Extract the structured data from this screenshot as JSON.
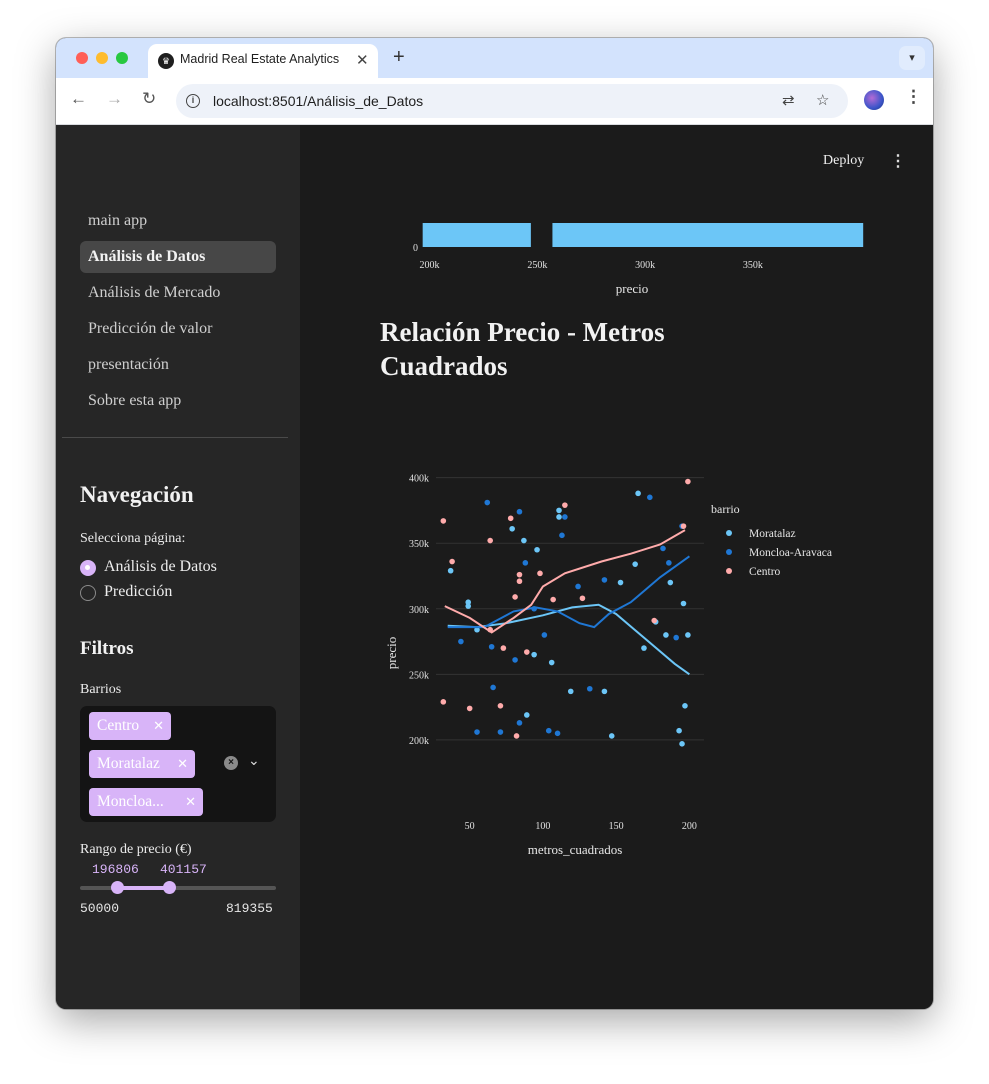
{
  "browser": {
    "tab_title": "Madrid Real Estate Analytics",
    "url": "localhost:8501/Análisis_de_Datos"
  },
  "sidebar": {
    "pages": [
      "main app",
      "Análisis de Datos",
      "Análisis de Mercado",
      "Predicción de valor",
      "presentación",
      "Sobre esta app"
    ],
    "active_page": "Análisis de Datos",
    "nav_title": "Navegación",
    "radio_label": "Selecciona página:",
    "radio_options": [
      "Análisis de Datos",
      "Predicción"
    ],
    "radio_selected": "Análisis de Datos",
    "filters_title": "Filtros",
    "barrios_label": "Barrios",
    "barrios_selected": [
      "Centro",
      "Moratalaz",
      "Moncloa..."
    ],
    "price_range_label": "Rango de precio (€)",
    "price_range": {
      "low": "196806",
      "high": "401157",
      "min": "50000",
      "max": "819355"
    }
  },
  "header": {
    "deploy_label": "Deploy"
  },
  "section_title": "Relación Precio - Metros Cuadrados",
  "colors": {
    "moratalaz": "#6cc6f7",
    "moncloa": "#1f77d4",
    "centro": "#ffabab",
    "accent": "#d8b4f8"
  },
  "chart_data": [
    {
      "type": "bar",
      "title": "",
      "xlabel": "precio",
      "ylabel": "",
      "y_tick": "0",
      "x_ticks": [
        "200k",
        "250k",
        "300k",
        "350k"
      ],
      "xlim": [
        190000,
        402000
      ],
      "bins": [
        {
          "x0": 196806,
          "x1": 247000
        },
        {
          "x0": 257000,
          "x1": 401157
        }
      ]
    },
    {
      "type": "scatter",
      "title": "",
      "xlabel": "metros_cuadrados",
      "ylabel": "precio",
      "xlim": [
        27,
        210
      ],
      "ylim": [
        190000,
        402000
      ],
      "x_ticks": [
        50,
        100,
        150,
        200
      ],
      "y_ticks": [
        200000,
        250000,
        300000,
        350000,
        400000
      ],
      "y_tick_labels": [
        "200k",
        "250k",
        "300k",
        "350k",
        "400k"
      ],
      "legend": {
        "title": "barrio",
        "position": "right"
      },
      "series": [
        {
          "name": "Moratalaz",
          "points": [
            [
              37,
              329000
            ],
            [
              49,
              302000
            ],
            [
              49,
              305000
            ],
            [
              55,
              284000
            ],
            [
              79,
              361000
            ],
            [
              87,
              352000
            ],
            [
              89,
              219000
            ],
            [
              94,
              265000
            ],
            [
              96,
              345000
            ],
            [
              106,
              259000
            ],
            [
              111,
              375000
            ],
            [
              111,
              370000
            ],
            [
              119,
              237000
            ],
            [
              142,
              237000
            ],
            [
              147,
              203000
            ],
            [
              153,
              320000
            ],
            [
              163,
              334000
            ],
            [
              165,
              388000
            ],
            [
              169,
              270000
            ],
            [
              177,
              290000
            ],
            [
              184,
              280000
            ],
            [
              187,
              320000
            ],
            [
              193,
              207000
            ],
            [
              195,
              197000
            ],
            [
              196,
              304000
            ],
            [
              197,
              226000
            ],
            [
              199,
              280000
            ]
          ],
          "trend": [
            [
              35,
              287000
            ],
            [
              55,
              286000
            ],
            [
              75,
              289000
            ],
            [
              100,
              295000
            ],
            [
              120,
              301000
            ],
            [
              138,
              303000
            ],
            [
              150,
              296000
            ],
            [
              170,
              277000
            ],
            [
              190,
              258000
            ],
            [
              200,
              250000
            ]
          ]
        },
        {
          "name": "Moncloa-Aravaca",
          "points": [
            [
              44,
              275000
            ],
            [
              55,
              206000
            ],
            [
              62,
              381000
            ],
            [
              65,
              271000
            ],
            [
              66,
              240000
            ],
            [
              71,
              206000
            ],
            [
              81,
              261000
            ],
            [
              84,
              374000
            ],
            [
              84,
              213000
            ],
            [
              88,
              335000
            ],
            [
              94,
              300000
            ],
            [
              101,
              280000
            ],
            [
              104,
              207000
            ],
            [
              110,
              205000
            ],
            [
              113,
              356000
            ],
            [
              115,
              370000
            ],
            [
              124,
              317000
            ],
            [
              132,
              239000
            ],
            [
              142,
              322000
            ],
            [
              173,
              385000
            ],
            [
              182,
              346000
            ],
            [
              186,
              335000
            ],
            [
              191,
              278000
            ],
            [
              195,
              363000
            ]
          ],
          "trend": [
            [
              35,
              286000
            ],
            [
              60,
              286000
            ],
            [
              80,
              298000
            ],
            [
              95,
              301000
            ],
            [
              110,
              298000
            ],
            [
              125,
              289000
            ],
            [
              135,
              286000
            ],
            [
              145,
              296000
            ],
            [
              160,
              305000
            ],
            [
              180,
              324000
            ],
            [
              200,
              340000
            ]
          ]
        },
        {
          "name": "Centro",
          "points": [
            [
              32,
              367000
            ],
            [
              32,
              229000
            ],
            [
              38,
              336000
            ],
            [
              50,
              224000
            ],
            [
              64,
              352000
            ],
            [
              64,
              284000
            ],
            [
              71,
              226000
            ],
            [
              73,
              270000
            ],
            [
              78,
              369000
            ],
            [
              81,
              309000
            ],
            [
              82,
              203000
            ],
            [
              84,
              326000
            ],
            [
              84,
              321000
            ],
            [
              89,
              267000
            ],
            [
              98,
              327000
            ],
            [
              107,
              307000
            ],
            [
              115,
              379000
            ],
            [
              127,
              308000
            ],
            [
              176,
              291000
            ],
            [
              196,
              363000
            ],
            [
              199,
              397000
            ]
          ],
          "trend": [
            [
              33,
              302000
            ],
            [
              50,
              293000
            ],
            [
              65,
              282000
            ],
            [
              80,
              293000
            ],
            [
              92,
              303000
            ],
            [
              100,
              317000
            ],
            [
              115,
              327000
            ],
            [
              140,
              336000
            ],
            [
              160,
              342000
            ],
            [
              180,
              349000
            ],
            [
              197,
              360000
            ]
          ]
        }
      ]
    }
  ]
}
